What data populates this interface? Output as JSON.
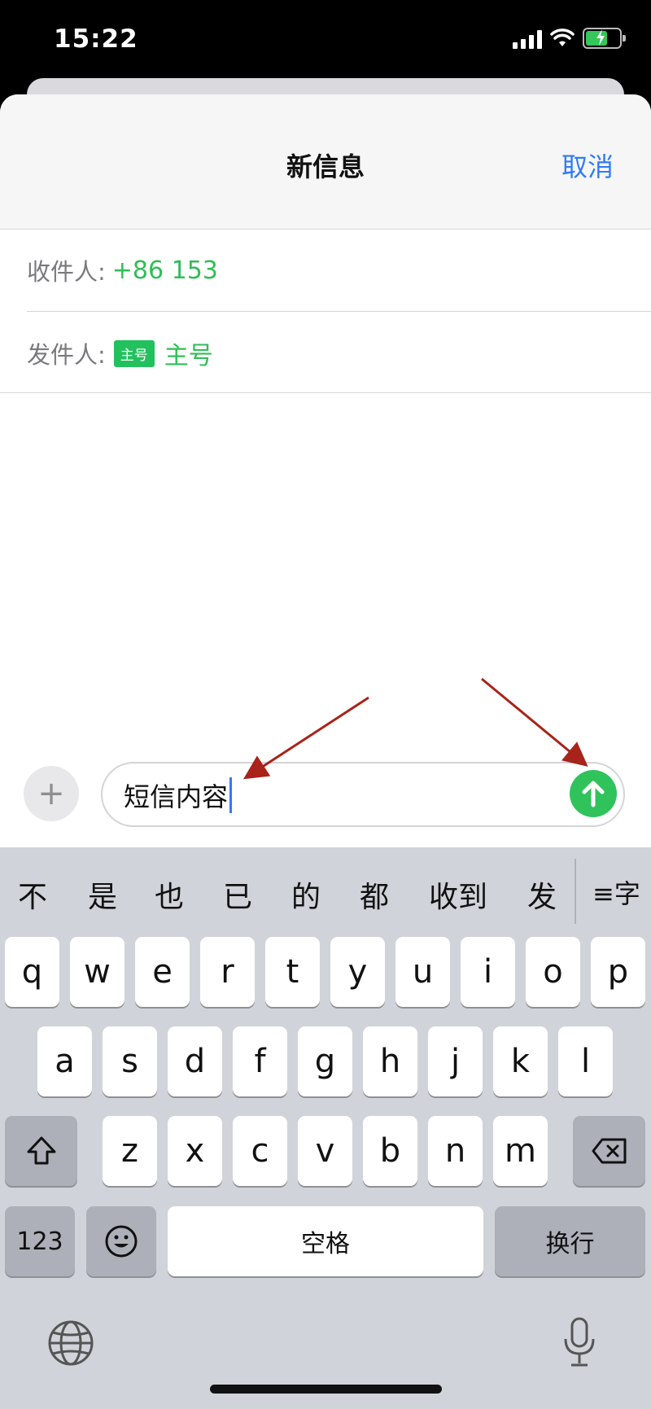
{
  "status_bar": {
    "time": "15:22"
  },
  "nav": {
    "title": "新信息",
    "cancel": "取消"
  },
  "recipient": {
    "label": "收件人:",
    "value": "+86 153"
  },
  "sender": {
    "label": "发件人:",
    "tag": "主号",
    "value": "主号"
  },
  "compose": {
    "text": "短信内容"
  },
  "keyboard": {
    "candidates": [
      "不",
      "是",
      "也",
      "已",
      "的",
      "都",
      "收到",
      "发"
    ],
    "more_candidates": "≡字",
    "row1": [
      "q",
      "w",
      "e",
      "r",
      "t",
      "y",
      "u",
      "i",
      "o",
      "p"
    ],
    "row2": [
      "a",
      "s",
      "d",
      "f",
      "g",
      "h",
      "j",
      "k",
      "l"
    ],
    "row3": [
      "z",
      "x",
      "c",
      "v",
      "b",
      "n",
      "m"
    ],
    "numbers": "123",
    "space": "空格",
    "return": "换行"
  },
  "colors": {
    "accent_blue": "#2f7cf6",
    "green": "#2fbe56",
    "send_green": "#30c35b",
    "arrow_red": "#a8231a"
  }
}
